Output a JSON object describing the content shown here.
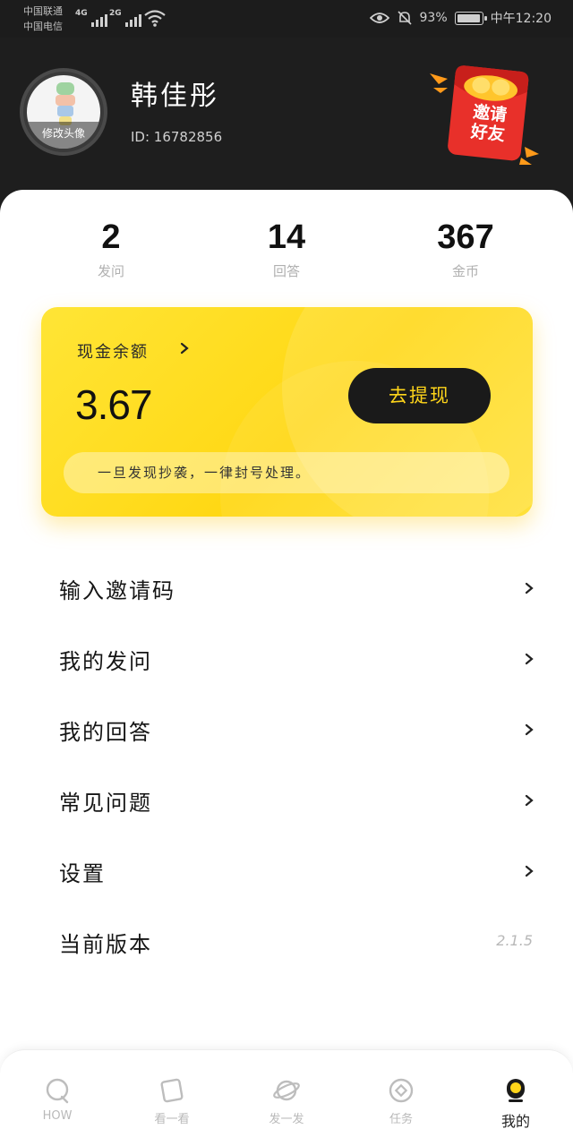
{
  "status_bar": {
    "carrier1": "中国联通",
    "carrier2": "中国电信",
    "net1": "4G",
    "net2": "2G",
    "battery": "93%",
    "time": "中午12:20"
  },
  "profile": {
    "avatar_label": "修改头像",
    "name": "韩佳彤",
    "id": "ID: 16782856",
    "invite_badge": "邀请好友"
  },
  "stats": [
    {
      "value": "2",
      "label": "发问"
    },
    {
      "value": "14",
      "label": "回答"
    },
    {
      "value": "367",
      "label": "金币"
    }
  ],
  "wallet": {
    "title": "现金余额",
    "balance": "3.67",
    "withdraw_label": "去提现",
    "notice": "一旦发现抄袭，一律封号处理。"
  },
  "menu": [
    {
      "label": "输入邀请码",
      "value": ""
    },
    {
      "label": "我的发问",
      "value": ""
    },
    {
      "label": "我的回答",
      "value": ""
    },
    {
      "label": "常见问题",
      "value": ""
    },
    {
      "label": "设置",
      "value": ""
    },
    {
      "label": "当前版本",
      "value": "2.1.5"
    }
  ],
  "tabs": [
    {
      "label": "HOW",
      "icon": "speech-bubble-icon"
    },
    {
      "label": "看一看",
      "icon": "card-icon"
    },
    {
      "label": "发一发",
      "icon": "planet-icon"
    },
    {
      "label": "任务",
      "icon": "coin-icon"
    },
    {
      "label": "我的",
      "icon": "profile-icon"
    }
  ],
  "colors": {
    "accent_yellow": "#FFD814",
    "dark": "#1E1E1E",
    "invite_red": "#E8302A"
  }
}
